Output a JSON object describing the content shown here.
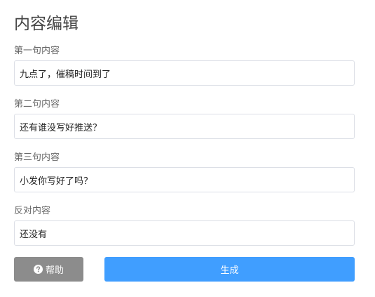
{
  "header": {
    "title": "内容编辑"
  },
  "fields": [
    {
      "label": "第一句内容",
      "value": "九点了，催稿时间到了"
    },
    {
      "label": "第二句内容",
      "value": "还有谁没写好推送？"
    },
    {
      "label": "第三句内容",
      "value": "小发你写好了吗？"
    },
    {
      "label": "反对内容",
      "value": "还没有"
    }
  ],
  "actions": {
    "help_label": "帮助",
    "help_icon": "question-circle-icon",
    "generate_label": "生成"
  },
  "colors": {
    "primary": "#409eff",
    "help_button": "#8c8c8c",
    "input_border": "#dcdfe6"
  }
}
